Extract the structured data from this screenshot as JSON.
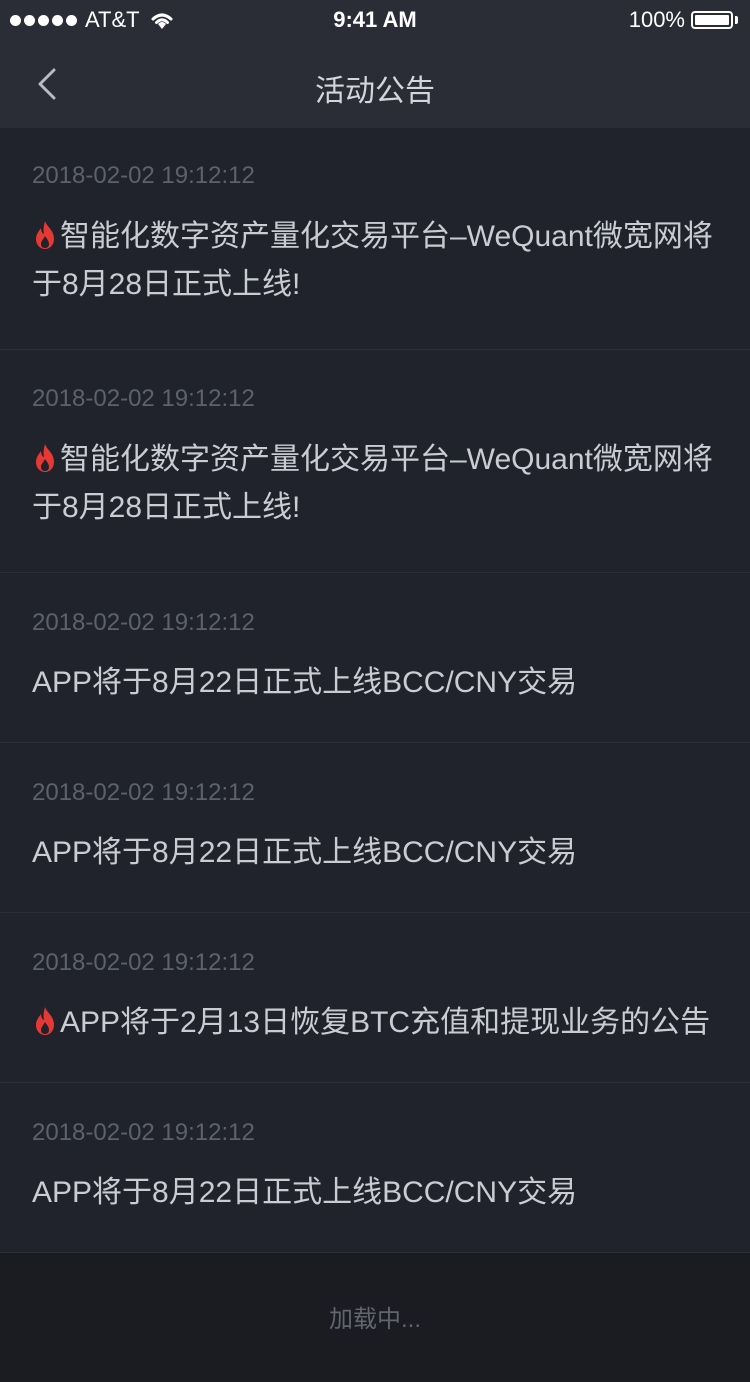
{
  "status_bar": {
    "carrier": "AT&T",
    "time": "9:41 AM",
    "battery": "100%"
  },
  "nav": {
    "title": "活动公告"
  },
  "announcements": [
    {
      "time": "2018-02-02 19:12:12",
      "hot": true,
      "title": "智能化数字资产量化交易平台–WeQuant微宽网将于8月28日正式上线!"
    },
    {
      "time": "2018-02-02 19:12:12",
      "hot": true,
      "title": "智能化数字资产量化交易平台–WeQuant微宽网将于8月28日正式上线!"
    },
    {
      "time": "2018-02-02 19:12:12",
      "hot": false,
      "title": "APP将于8月22日正式上线BCC/CNY交易"
    },
    {
      "time": "2018-02-02 19:12:12",
      "hot": false,
      "title": "APP将于8月22日正式上线BCC/CNY交易"
    },
    {
      "time": "2018-02-02 19:12:12",
      "hot": true,
      "title": "APP将于2月13日恢复BTC充值和提现业务的公告"
    },
    {
      "time": "2018-02-02 19:12:12",
      "hot": false,
      "title": "APP将于8月22日正式上线BCC/CNY交易"
    }
  ],
  "footer": {
    "loading_text": "加载中..."
  },
  "colors": {
    "accent_fire": "#e53935",
    "background": "#20232b"
  }
}
